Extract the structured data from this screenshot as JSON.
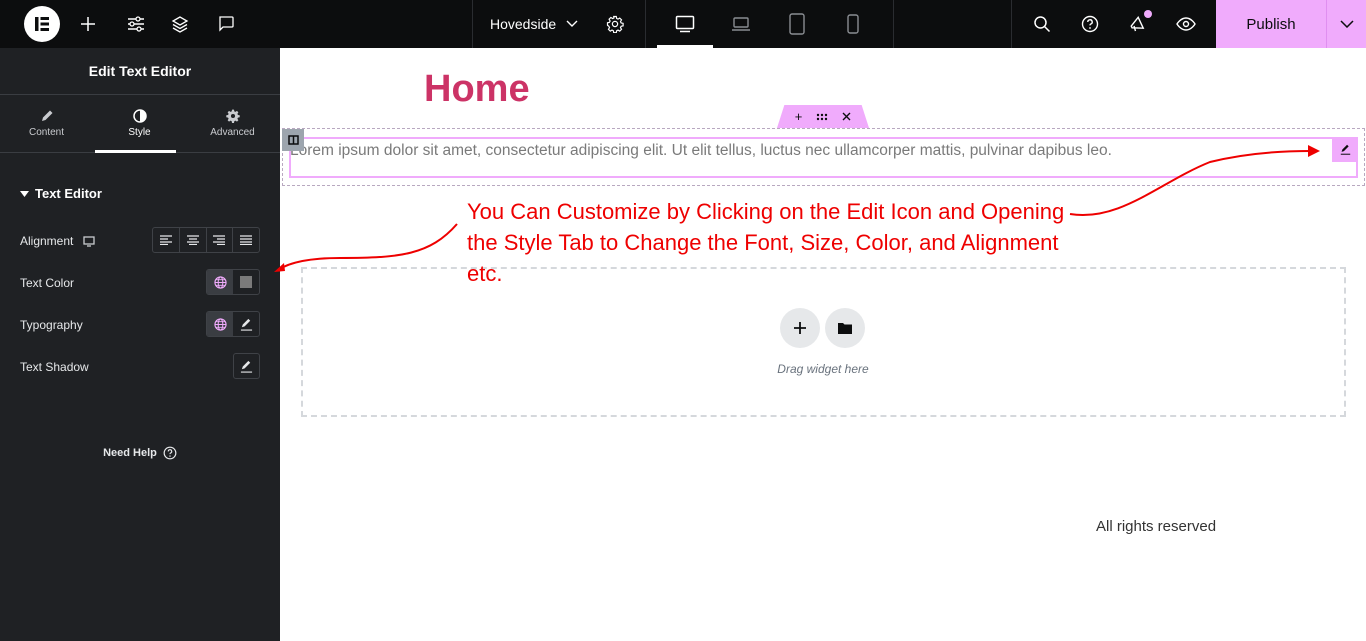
{
  "topbar": {
    "page_name": "Hovedside",
    "publish_label": "Publish",
    "accent_color": "#f0abfc"
  },
  "panel": {
    "title": "Edit Text Editor",
    "tabs": [
      {
        "label": "Content",
        "icon": "pencil-icon"
      },
      {
        "label": "Style",
        "icon": "half-circle-icon",
        "active": true
      },
      {
        "label": "Advanced",
        "icon": "gear-icon"
      }
    ],
    "section_title": "Text Editor",
    "controls": {
      "alignment": "Alignment",
      "text_color": "Text Color",
      "typography": "Typography",
      "text_shadow": "Text Shadow"
    },
    "need_help": "Need Help"
  },
  "canvas": {
    "heading": "Home",
    "heading_color": "#cc3366",
    "body_text": "Lorem ipsum dolor sit amet, consectetur adipiscing elit. Ut elit tellus, luctus nec ullamcorper mattis, pulvinar dapibus leo.",
    "drop_zone_text": "Drag widget here",
    "footer": "All rights reserved",
    "annotation": "You Can Customize by Clicking on the Edit Icon and Opening the Style Tab to Change the Font, Size, Color, and Alignment etc.",
    "annotation_color": "#ee0000"
  }
}
